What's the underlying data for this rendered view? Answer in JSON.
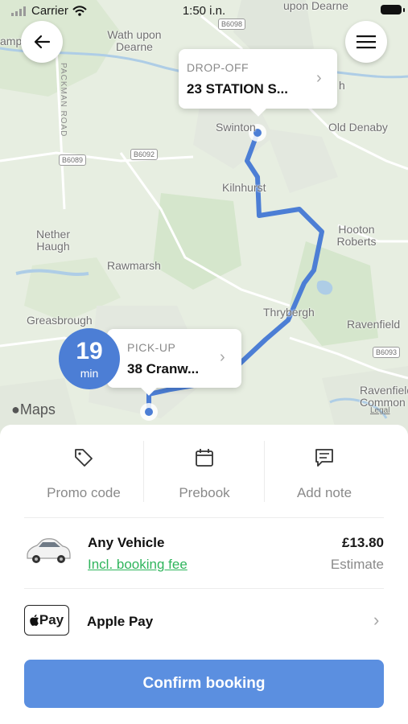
{
  "status_bar": {
    "carrier": "Carrier",
    "time": "1:50 i.n."
  },
  "map": {
    "place_labels": [
      "upon Dearne",
      "Wath upon Dearne",
      "Swinton",
      "Old Denaby",
      "Kilnhurst",
      "Hooton Roberts",
      "Nether Haugh",
      "Rawmarsh",
      "Thrybergh",
      "Ravenfield",
      "Greasbrough",
      "Ravenfield Common",
      "h"
    ],
    "road_labels": [
      "PACKMAN ROAD",
      "B6098",
      "B6089",
      "B6092",
      "B6093",
      "amp"
    ],
    "attribution": "Maps",
    "legal": "Legal"
  },
  "drop_off": {
    "tag": "DROP-OFF",
    "address": "23 STATION S..."
  },
  "pick_up": {
    "tag": "PICK-UP",
    "address": "38 Cranw...",
    "eta_minutes": "19",
    "eta_unit": "min"
  },
  "options": [
    {
      "label": "Promo code",
      "icon": "tag-icon"
    },
    {
      "label": "Prebook",
      "icon": "calendar-icon"
    },
    {
      "label": "Add note",
      "icon": "note-icon"
    }
  ],
  "vehicle": {
    "name": "Any Vehicle",
    "fee_note": "Incl. booking fee",
    "price": "£13.80",
    "price_note": "Estimate"
  },
  "payment": {
    "badge": "Pay",
    "method": "Apple Pay"
  },
  "confirm_label": "Confirm booking",
  "colors": {
    "route": "#4c7ed5",
    "confirm": "#5b8fe0",
    "fee_link": "#2fb55c"
  }
}
